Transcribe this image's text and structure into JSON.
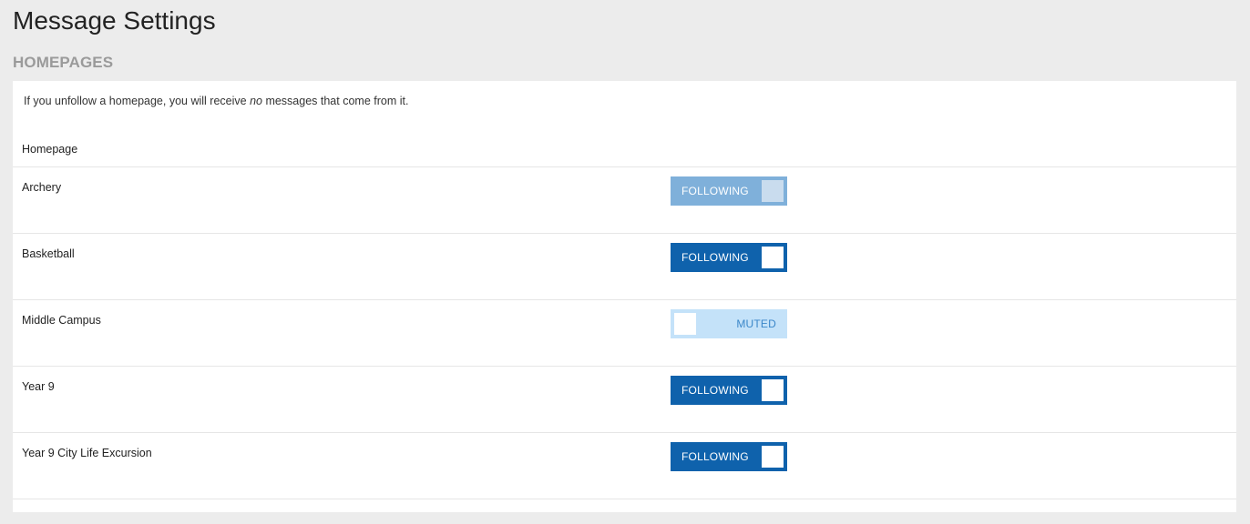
{
  "page": {
    "title": "Message Settings"
  },
  "section": {
    "title": "HOMEPAGES",
    "intro_before": "If you unfollow a homepage, you will receive ",
    "intro_emphasis": "no",
    "intro_after": " messages that come from it.",
    "column_header": "Homepage"
  },
  "homepages": [
    {
      "name": "Archery",
      "state": "following",
      "label": "FOLLOWING",
      "disabled": true
    },
    {
      "name": "Basketball",
      "state": "following",
      "label": "FOLLOWING",
      "disabled": false
    },
    {
      "name": "Middle Campus",
      "state": "muted",
      "label": "MUTED",
      "disabled": false
    },
    {
      "name": "Year 9",
      "state": "following",
      "label": "FOLLOWING",
      "disabled": false
    },
    {
      "name": "Year 9 City Life Excursion",
      "state": "following",
      "label": "FOLLOWING",
      "disabled": false
    }
  ],
  "colors": {
    "following": "#0f62ac",
    "following_disabled": "#7fb0da",
    "muted": "#c4e2f9",
    "muted_text": "#3b87c9"
  }
}
